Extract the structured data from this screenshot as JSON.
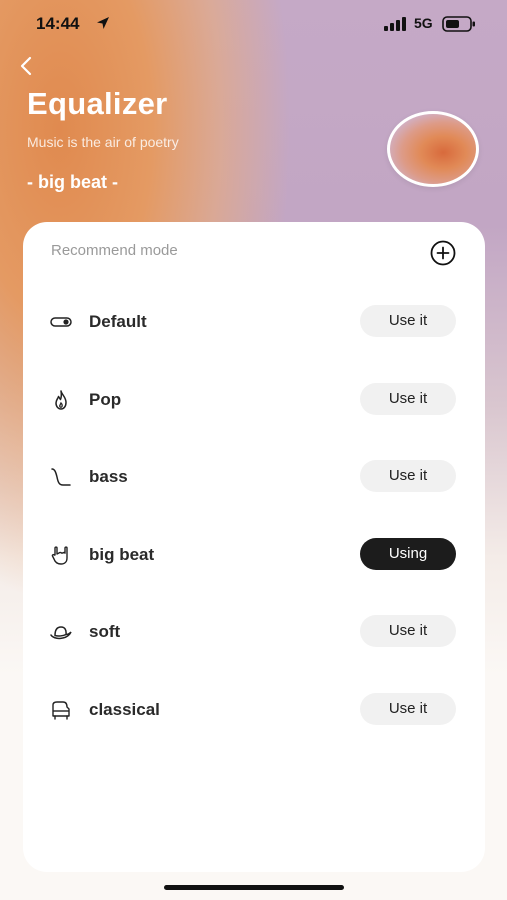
{
  "status_bar": {
    "time": "14:44",
    "network": "5G"
  },
  "header": {
    "title": "Equalizer",
    "subtitle": "Music is the air of poetry",
    "current_mode": "- big beat -"
  },
  "card": {
    "heading": "Recommend mode",
    "modes": [
      {
        "label": "Default",
        "icon": "toggle-icon",
        "button": "Use it",
        "active": false
      },
      {
        "label": "Pop",
        "icon": "flame-icon",
        "button": "Use it",
        "active": false
      },
      {
        "label": "bass",
        "icon": "bass-curve-icon",
        "button": "Use it",
        "active": false
      },
      {
        "label": "big beat",
        "icon": "rock-hand-icon",
        "button": "Using",
        "active": true
      },
      {
        "label": "soft",
        "icon": "hat-icon",
        "button": "Use it",
        "active": false
      },
      {
        "label": "classical",
        "icon": "piano-icon",
        "button": "Use it",
        "active": false
      }
    ]
  },
  "colors": {
    "accent_active": "#1c1c1c",
    "button_bg": "#f1f1f1",
    "header_orange": "#e08a4f",
    "header_lilac": "#c5a9c6"
  }
}
